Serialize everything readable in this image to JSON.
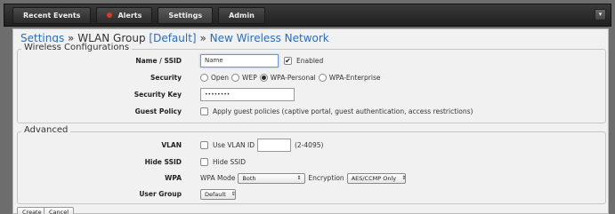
{
  "nav": {
    "tabs": [
      {
        "label": "Recent Events"
      },
      {
        "label": "Alerts"
      },
      {
        "label": "Settings"
      },
      {
        "label": "Admin"
      }
    ],
    "collapse_icon": "chevron-down-icon"
  },
  "breadcrumb": {
    "part1": "Settings",
    "sep1": "»",
    "part2": "WLAN Group",
    "part3": "[Default]",
    "sep2": "»",
    "part4": "New Wireless Network"
  },
  "wireless": {
    "legend": "Wireless Configurations",
    "name_label": "Name / SSID",
    "name_value": "Name",
    "enabled_label": "Enabled",
    "security_label": "Security",
    "security_options": [
      "Open",
      "WEP",
      "WPA-Personal",
      "WPA-Enterprise"
    ],
    "security_selected": "WPA-Personal",
    "key_label": "Security Key",
    "key_value": "••••••••",
    "guest_label": "Guest Policy",
    "guest_text": "Apply guest policies (captive portal, guest authentication, access restrictions)"
  },
  "advanced": {
    "legend": "Advanced",
    "vlan_label": "VLAN",
    "vlan_cb_text": "Use VLAN ID",
    "vlan_value": "",
    "vlan_range": "(2-4095)",
    "hide_label": "Hide SSID",
    "hide_cb_text": "Hide SSID",
    "wpa_label": "WPA",
    "wpa_mode_label": "WPA Mode",
    "wpa_mode_value": "Both",
    "encryption_label": "Encryption",
    "encryption_value": "AES/CCMP Only",
    "user_group_label": "User Group",
    "user_group_value": "Default"
  },
  "actions": {
    "create": "Create",
    "cancel": "Cancel"
  },
  "colors": {
    "accent": "#2d6db5",
    "alert": "#d93a2b",
    "topbar": "#2a2a2a"
  }
}
